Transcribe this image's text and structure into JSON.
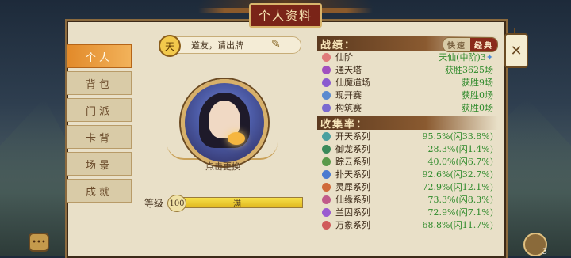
{
  "title": "个人资料",
  "sidebar": {
    "items": [
      {
        "label": "个人",
        "active": true
      },
      {
        "label": "背包",
        "active": false
      },
      {
        "label": "门派",
        "active": false
      },
      {
        "label": "卡背",
        "active": false
      },
      {
        "label": "场景",
        "active": false
      },
      {
        "label": "成就",
        "active": false
      }
    ]
  },
  "profile": {
    "badge": "天",
    "message": "道友，请出牌",
    "swap_label": "点击更换",
    "level_label": "等级",
    "level_value": "100",
    "level_text": "满",
    "level_progress": 1.0
  },
  "stats": {
    "header": "战绩：",
    "toggle": {
      "off": "快速",
      "on": "经典"
    },
    "rows": [
      {
        "label": "仙阶",
        "value": "天仙(中阶)3",
        "star": "✦",
        "icon_color": "#e07a7a",
        "icon": "star-icon"
      },
      {
        "label": "通天塔",
        "value": "获胜3625场",
        "icon_color": "#a050c0",
        "icon": "tower-icon"
      },
      {
        "label": "仙魔道场",
        "value": "获胜9场",
        "icon_color": "#8a5ad0",
        "icon": "arena-icon"
      },
      {
        "label": "现开赛",
        "value": "获胜0场",
        "icon_color": "#5a8ad0",
        "icon": "match-icon"
      },
      {
        "label": "构筑赛",
        "value": "获胜0场",
        "icon_color": "#7a6ad0",
        "icon": "build-icon"
      }
    ]
  },
  "collection": {
    "header": "收集率：",
    "rows": [
      {
        "label": "开天系列",
        "value": "95.5%(闪33.8%)",
        "icon_color": "#4aa0a0"
      },
      {
        "label": "御龙系列",
        "value": "28.3%(闪1.4%)",
        "icon_color": "#3a8a5a"
      },
      {
        "label": "踪云系列",
        "value": "40.0%(闪6.7%)",
        "icon_color": "#5a9a4a"
      },
      {
        "label": "扑天系列",
        "value": "92.6%(闪32.7%)",
        "icon_color": "#4a7ad0"
      },
      {
        "label": "灵犀系列",
        "value": "72.9%(闪12.1%)",
        "icon_color": "#d06a3a"
      },
      {
        "label": "仙缘系列",
        "value": "73.3%(闪8.3%)",
        "icon_color": "#c05a8a"
      },
      {
        "label": "兰因系列",
        "value": "72.9%(闪7.1%)",
        "icon_color": "#9a5ad0"
      },
      {
        "label": "万象系列",
        "value": "68.8%(闪11.7%)",
        "icon_color": "#d05a5a"
      }
    ]
  },
  "close_symbol": "✕",
  "chat_symbol": "•••",
  "bag_count": "3"
}
